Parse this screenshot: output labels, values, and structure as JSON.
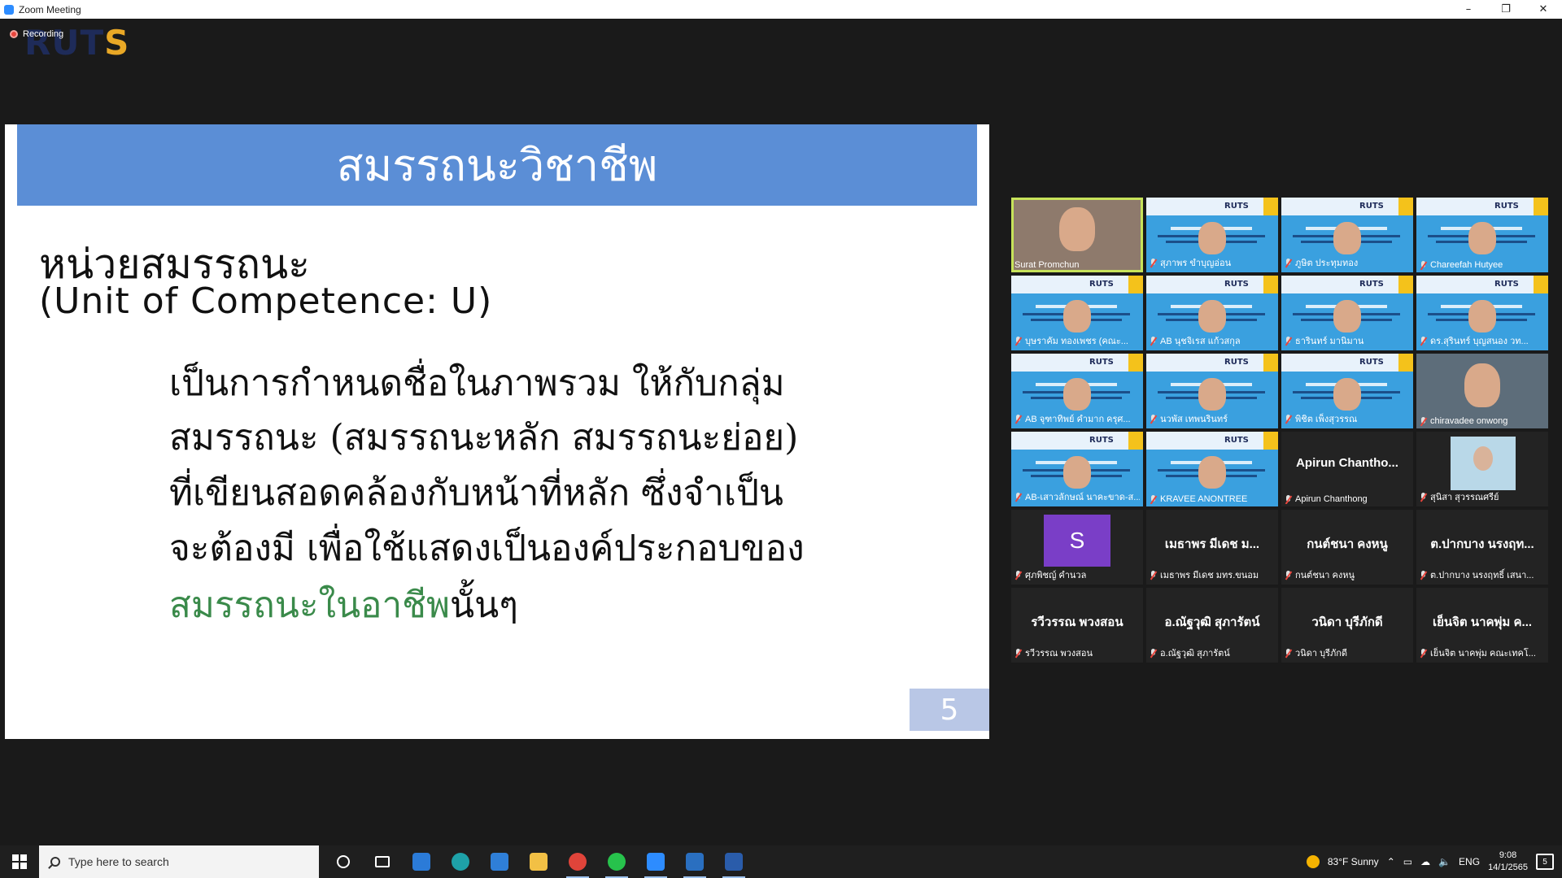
{
  "window": {
    "title": "Zoom Meeting",
    "minimize": "–",
    "restore": "❐",
    "close": "✕"
  },
  "recording": {
    "label": "Recording"
  },
  "logo": {
    "part1": "RUT",
    "part2": "S"
  },
  "slide": {
    "title": "สมรรถนะวิชาชีพ",
    "heading": "หน่วยสมรรถนะ",
    "subheading": "(Unit of Competence: U)",
    "lines": [
      "เป็นการกำหนดชื่อในภาพรวม ให้กับกลุ่ม",
      "สมรรถนะ (สมรรถนะหลัก สมรรถนะย่อย)",
      "ที่เขียนสอดคล้องกับหน้าที่หลัก ซึ่งจำเป็น",
      "จะต้องมี เพื่อใช้แสดงเป็นองค์ประกอบของ"
    ],
    "last_line_green": "สมรรถนะในอาชีพ",
    "last_line_tail": "นั้นๆ",
    "page_number": "5"
  },
  "participants": [
    {
      "name": "Surat Promchun",
      "type": "video",
      "active": true
    },
    {
      "name": "สุภาพร ขำบุญอ่อน",
      "type": "slide"
    },
    {
      "name": "ภูษิต ประทุมทอง",
      "type": "slide"
    },
    {
      "name": "Chareefah Hutyee",
      "type": "slide"
    },
    {
      "name": "บุษราคัม ทองเพชร (คณะ...",
      "type": "slide"
    },
    {
      "name": "AB นุชจิเรส แก้วสกุล",
      "type": "slide"
    },
    {
      "name": "ธารินทร์ มานิมาน",
      "type": "slide"
    },
    {
      "name": "ดร.สุรินทร์ บุญสนอง วท...",
      "type": "slide"
    },
    {
      "name": "AB จุฑาทิพย์ คำมาก ครุศ...",
      "type": "slide"
    },
    {
      "name": "นวพัส เทพนรินทร์",
      "type": "slide"
    },
    {
      "name": "พิชิต เพ็งสุวรรณ",
      "type": "slide"
    },
    {
      "name": "chiravadee onwong",
      "type": "video2"
    },
    {
      "name": "AB-เสาวลักษณ์ นาคะขาด-ส...",
      "type": "slide"
    },
    {
      "name": "KRAVEE ANONTREE",
      "type": "slide"
    },
    {
      "name": "Apirun Chanthong",
      "type": "nametile",
      "big": "Apirun Chantho..."
    },
    {
      "name": "สุนิสา สุวรรณศรีย์",
      "type": "photo"
    },
    {
      "name": "ศุภพิชญ์ คำนวล",
      "type": "avatar",
      "initial": "S"
    },
    {
      "name": "เมธาพร มีเดช มทร.ขนอม",
      "type": "nametile",
      "big": "เมธาพร มีเดช ม..."
    },
    {
      "name": "กนต์ชนา คงหนู",
      "type": "nametile",
      "big": "กนต์ชนา คงหนู"
    },
    {
      "name": "ต.ปากบาง นรงฤทธิ์ เสนา...",
      "type": "nametile",
      "big": "ต.ปากบาง นรงฤท..."
    },
    {
      "name": "รวีวรรณ พวงสอน",
      "type": "nametile",
      "big": "รวีวรรณ พวงสอน"
    },
    {
      "name": "อ.ณัฐวุฒิ สุภารัตน์",
      "type": "nametile",
      "big": "อ.ณัฐวุฒิ สุภารัตน์"
    },
    {
      "name": "วนิดา บุรีภักดี",
      "type": "nametile",
      "big": "วนิดา บุรีภักดี"
    },
    {
      "name": "เย็นจิต นาคพุ่ม คณะเทคโ...",
      "type": "nametile",
      "big": "เย็นจิต นาคพุ่ม ค..."
    }
  ],
  "taskbar": {
    "search_placeholder": "Type here to search",
    "apps": [
      {
        "icon": "cortana-icon",
        "color": "#1f1f1f"
      },
      {
        "icon": "task-view-icon",
        "color": "#1f1f1f"
      },
      {
        "icon": "store-icon",
        "color": "#2b7bd8"
      },
      {
        "icon": "edge-icon",
        "color": "#1ea1a8"
      },
      {
        "icon": "mail-icon",
        "color": "#2f7fd8"
      },
      {
        "icon": "file-explorer-icon",
        "color": "#f2c045"
      },
      {
        "icon": "chrome-icon",
        "color": "#e0443a"
      },
      {
        "icon": "line-icon",
        "color": "#27c24c"
      },
      {
        "icon": "zoom-icon",
        "color": "#2d8cff"
      },
      {
        "icon": "photos-icon",
        "color": "#2a6fc0"
      },
      {
        "icon": "word-icon",
        "color": "#2a5caa"
      }
    ],
    "weather": "83°F  Sunny",
    "language": "ENG",
    "time": "9:08",
    "date": "14/1/2565",
    "notifications": "5"
  }
}
